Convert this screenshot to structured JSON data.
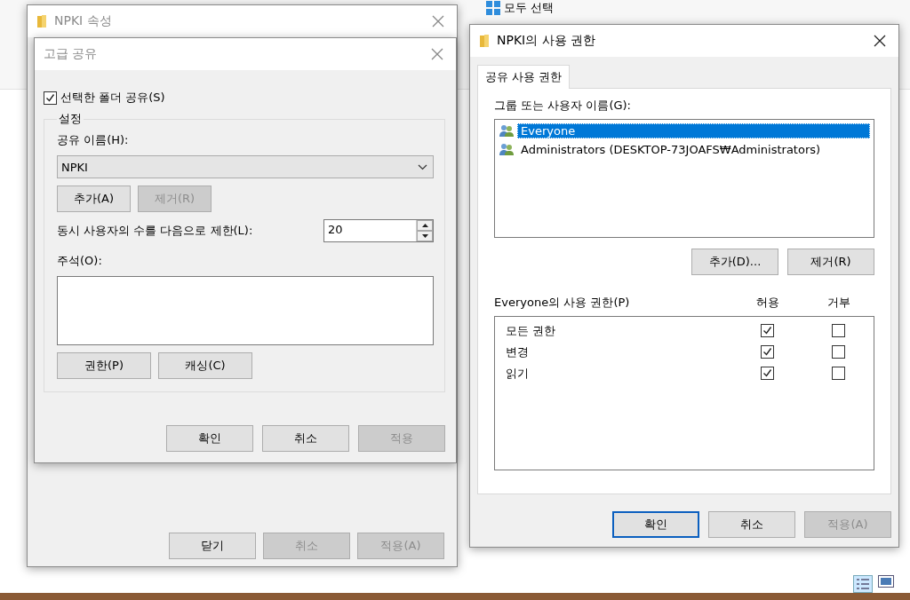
{
  "explorer": {
    "toolbar_items": [
      "모두 선택"
    ]
  },
  "properties_window": {
    "title": "NPKI 속성",
    "buttons": [
      {
        "label": "닫기",
        "disabled": false
      },
      {
        "label": "취소",
        "disabled": true
      },
      {
        "label": "적용(A)",
        "disabled": true
      }
    ]
  },
  "advanced_sharing": {
    "title": "고급 공유",
    "share_checkbox": {
      "label": "선택한 폴더 공유(S)",
      "checked": true
    },
    "group_title": "설정",
    "share_name_label": "공유 이름(H):",
    "share_name": "NPKI",
    "name_buttons": [
      {
        "label": "추가(A)",
        "disabled": false
      },
      {
        "label": "제거(R)",
        "disabled": true
      }
    ],
    "limit_label": "동시 사용자의 수를 다음으로 제한(L):",
    "limit_value": "20",
    "comment_label": "주석(O):",
    "extra_buttons": [
      {
        "label": "권한(P)",
        "disabled": false
      },
      {
        "label": "캐싱(C)",
        "disabled": false
      }
    ],
    "buttons": [
      {
        "label": "확인",
        "disabled": false
      },
      {
        "label": "취소",
        "disabled": false
      },
      {
        "label": "적용",
        "disabled": true
      }
    ]
  },
  "permissions_window": {
    "title": "NPKI의 사용 권한",
    "tabs": [
      {
        "label": "공유 사용 권한",
        "selected": true
      }
    ],
    "users_label": "그룹 또는 사용자 이름(G):",
    "users": [
      {
        "name": "Everyone",
        "selected": true
      },
      {
        "name": "Administrators (DESKTOP-73JOAFS₩Administrators)",
        "selected": false
      }
    ],
    "user_buttons": [
      {
        "label": "추가(D)...",
        "disabled": false
      },
      {
        "label": "제거(R)",
        "disabled": false
      }
    ],
    "permissions_label": "Everyone의 사용 권한(P)",
    "columns": [
      "허용",
      "거부"
    ],
    "permissions": [
      {
        "name": "모든 권한",
        "allow": true,
        "deny": false
      },
      {
        "name": "변경",
        "allow": true,
        "deny": false
      },
      {
        "name": "읽기",
        "allow": true,
        "deny": false
      }
    ],
    "buttons": [
      {
        "label": "확인",
        "disabled": false,
        "default": true
      },
      {
        "label": "취소",
        "disabled": false,
        "default": false
      },
      {
        "label": "적용(A)",
        "disabled": true,
        "default": false
      }
    ]
  }
}
